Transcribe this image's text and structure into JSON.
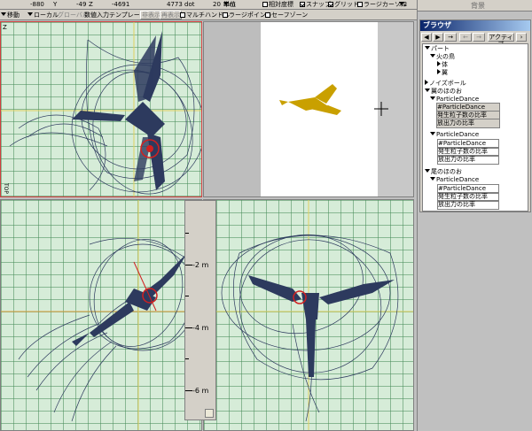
{
  "status": {
    "x": "-880",
    "y_label": "Y",
    "y": "-49",
    "z_label": "Z",
    "z": "-4691",
    "dot": "4773 dot",
    "value20": "20"
  },
  "toolbar": {
    "unit_label": "単位",
    "unit_value": "mm",
    "relative_scale": "相対度標",
    "snap": "スナップ",
    "grid": "グリッド",
    "large_cursor": "ラージカーソル",
    "cursor_size": "X2",
    "mode": "移動",
    "local": "ローカル",
    "global": "グローバル",
    "numeric_template": "数値入力テンプレート",
    "hide_button": "非表示",
    "show_button": "再表示",
    "multi_handle": "マルチハンドル",
    "large_point": "ラージポイント",
    "safe_zone": "セーフゾーン"
  },
  "viewport": {
    "top_axis": "Z",
    "top_label": "TOP"
  },
  "ruler": {
    "labels": [
      "-2 m",
      "-4 m",
      "-6 m"
    ]
  },
  "panel": {
    "header": "背景",
    "browser_title": "ブラウザ",
    "tools": {
      "prev": "◀",
      "next": "▶",
      "activate": "アクティブ"
    },
    "tree": {
      "parts": "パート",
      "phoenix": "火の鳥",
      "body": "体",
      "wings": "翼",
      "noise_ball": "ノイズボール",
      "wing_flame": "翼のほのお",
      "particle_dance": "ParticleDance",
      "particle_dance_hash": "#ParticleDance",
      "emit_ratio": "発生粒子数の比率",
      "release_ratio": "放出力の比率",
      "tail_flame": "尾のほのお"
    }
  },
  "colors": {
    "grid_bg": "#d6ecd8",
    "grid_line": "#468c5a",
    "wire": "#2d3a5e",
    "accent": "#d02020",
    "bird_gold": "#c9a000",
    "title_bar": "#0a246a"
  }
}
